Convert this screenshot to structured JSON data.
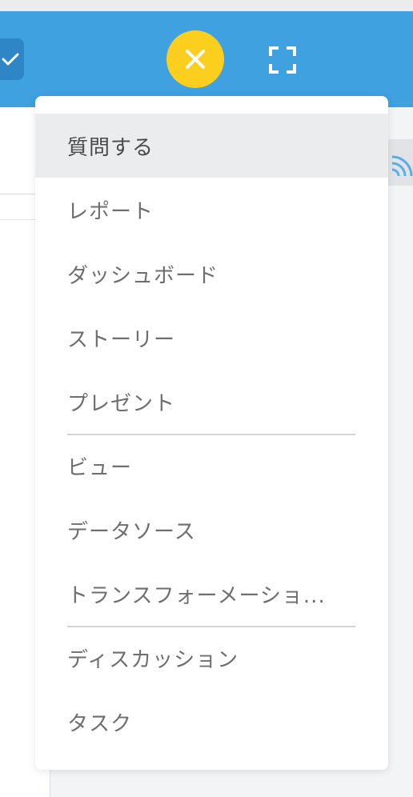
{
  "header": {
    "background_color": "#3fa1e0",
    "check_icon": "check-icon",
    "close_icon": "close-icon",
    "close_button_color": "#fccf1f",
    "expand_icon": "fullscreen-icon"
  },
  "background": {
    "wifi_icon": "wifi-icon"
  },
  "menu": {
    "items": [
      {
        "label": "質問する",
        "active": true
      },
      {
        "label": "レポート"
      },
      {
        "label": "ダッシュボード"
      },
      {
        "label": "ストーリー"
      },
      {
        "label": "プレゼント"
      },
      {
        "label": "ビュー"
      },
      {
        "label": "データソース"
      },
      {
        "label": "トランスフォーメーショ..."
      },
      {
        "label": "ディスカッション"
      },
      {
        "label": "タスク"
      }
    ]
  }
}
